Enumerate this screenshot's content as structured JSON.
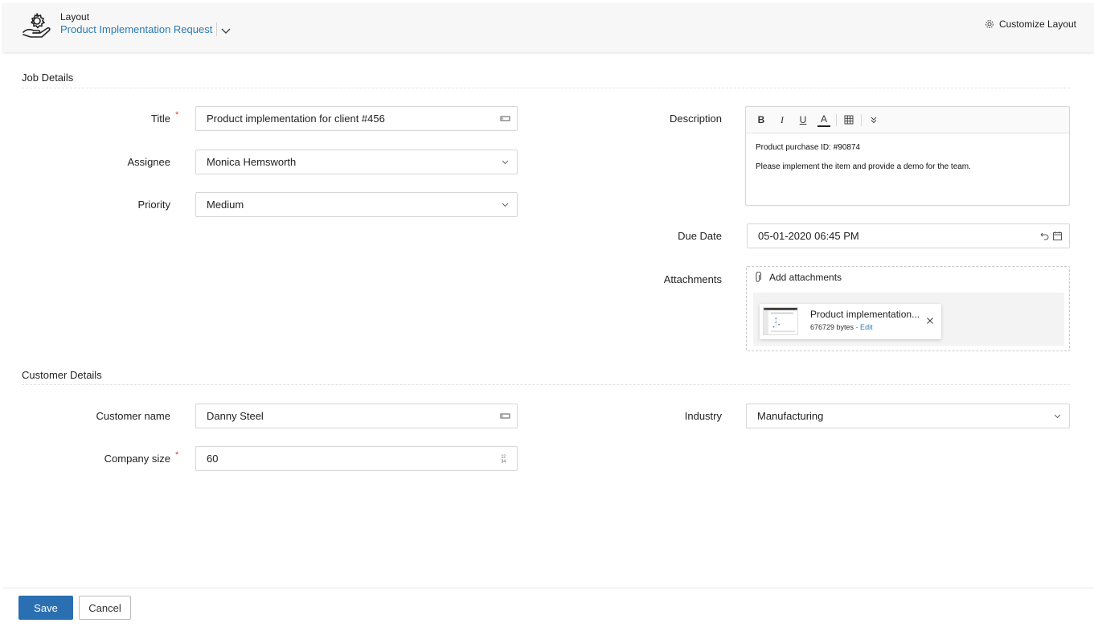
{
  "header": {
    "layout_label": "Layout",
    "layout_name": "Product Implementation Request",
    "customize_label": "Customize Layout"
  },
  "sections": {
    "job_details": "Job Details",
    "customer_details": "Customer Details"
  },
  "job": {
    "title_label": "Title",
    "title_value": "Product implementation for client #456",
    "assignee_label": "Assignee",
    "assignee_value": "Monica Hemsworth",
    "priority_label": "Priority",
    "priority_value": "Medium",
    "description_label": "Description",
    "description_lines": [
      "Product purchase ID: #90874",
      "Please implement the item and provide a demo for the team."
    ],
    "due_date_label": "Due Date",
    "due_date_value": "05-01-2020 06:45 PM",
    "attachments_label": "Attachments",
    "add_attachments_label": "Add attachments",
    "attachment": {
      "name": "Product implementation...",
      "size": "676729 bytes",
      "edit": "- Edit"
    }
  },
  "customer": {
    "name_label": "Customer name",
    "name_value": "Danny Steel",
    "company_size_label": "Company size",
    "company_size_value": "60",
    "industry_label": "Industry",
    "industry_value": "Manufacturing"
  },
  "required_marker": "*",
  "toolbar": {
    "bold": "B",
    "italic": "I",
    "underline": "U",
    "font_color": "A"
  },
  "footer": {
    "save_label": "Save",
    "cancel_label": "Cancel"
  },
  "colors": {
    "accent": "#2a6fb2",
    "link": "#2a7ab5",
    "required": "#e0403a"
  }
}
